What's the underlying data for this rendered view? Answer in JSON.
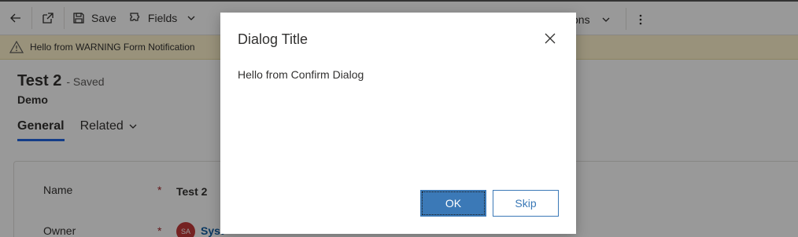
{
  "toolbar": {
    "save_label": "Save",
    "fields_label": "Fields",
    "options_fragment": "ons"
  },
  "notification": {
    "text": "Hello from WARNING Form Notification"
  },
  "record": {
    "title": "Test 2",
    "status": "- Saved",
    "entity": "Demo"
  },
  "tabs": [
    {
      "label": "General"
    },
    {
      "label": "Related"
    }
  ],
  "form": {
    "name_label": "Name",
    "name_value": "Test 2",
    "owner_label": "Owner",
    "owner_initials": "SA",
    "owner_fragment": "Syst",
    "required_mark": "*"
  },
  "dialog": {
    "title": "Dialog Title",
    "message": "Hello from Confirm Dialog",
    "ok_label": "OK",
    "skip_label": "Skip"
  },
  "colors": {
    "accent": "#3b79b7",
    "warning_bg": "#fff4ce",
    "overlay": "rgba(0,0,0,0.4)"
  },
  "icons": [
    "back-arrow-icon",
    "open-new-window-icon",
    "save-icon",
    "fields-icon",
    "chevron-down-icon",
    "more-icon",
    "warning-icon",
    "close-icon"
  ]
}
